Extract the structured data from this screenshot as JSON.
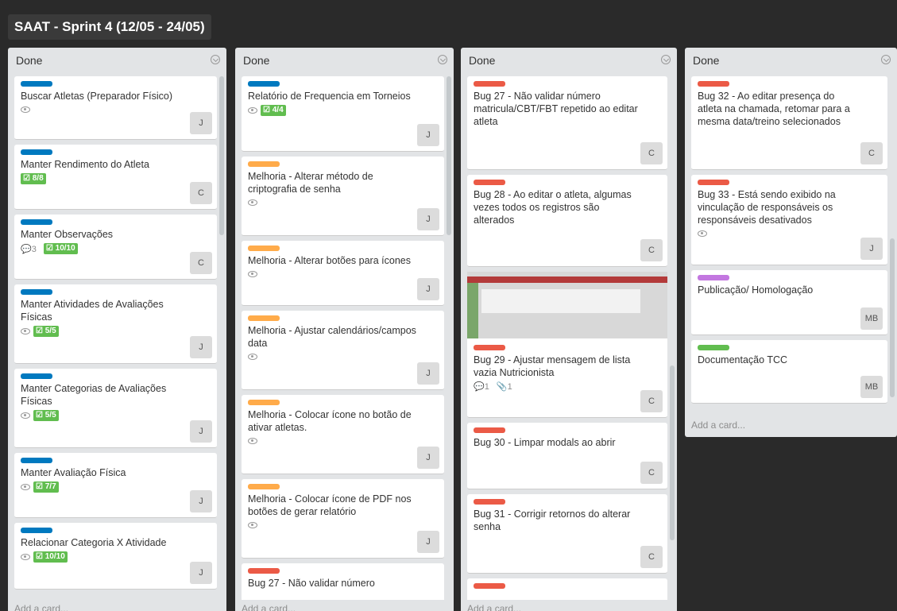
{
  "board": {
    "title": "SAAT - Sprint 4 (12/05 - 24/05)"
  },
  "lists": [
    {
      "title": "Done",
      "add_card": "Add a card...",
      "cards": [
        {
          "title": "Buscar Atletas (Preparador Físico)",
          "label": "blue",
          "watch": true,
          "member": "J"
        },
        {
          "title": "Manter Rendimento do Atleta",
          "label": "blue",
          "checklist": "8/8",
          "member": "C"
        },
        {
          "title": "Manter Observações",
          "label": "blue",
          "comments": "3",
          "checklist": "10/10",
          "member": "C"
        },
        {
          "title": "Manter Atividades de Avaliações Físicas",
          "label": "blue",
          "watch": true,
          "checklist": "5/5",
          "member": "J"
        },
        {
          "title": "Manter Categorias de Avaliações Físicas",
          "label": "blue",
          "watch": true,
          "checklist": "5/5",
          "member": "J"
        },
        {
          "title": "Manter Avaliação Física",
          "label": "blue",
          "watch": true,
          "checklist": "7/7",
          "member": "J"
        },
        {
          "title": "Relacionar Categoria X Atividade",
          "label": "blue",
          "watch": true,
          "checklist": "10/10",
          "member": "J"
        }
      ]
    },
    {
      "title": "Done",
      "add_card": "Add a card...",
      "cards": [
        {
          "title": "Relatório de Frequencia em Torneios",
          "label": "blue",
          "watch": true,
          "checklist": "4/4",
          "member": "J"
        },
        {
          "title": "Melhoria - Alterar método de criptografia de senha",
          "label": "orange",
          "watch": true,
          "member": "J"
        },
        {
          "title": "Melhoria - Alterar botões para ícones",
          "label": "orange",
          "watch": true,
          "member": "J"
        },
        {
          "title": "Melhoria - Ajustar calendários/campos data",
          "label": "orange",
          "watch": true,
          "member": "J"
        },
        {
          "title": "Melhoria - Colocar ícone no botão de ativar atletas.",
          "label": "orange",
          "watch": true,
          "member": "J"
        },
        {
          "title": "Melhoria - Colocar ícone de PDF nos botões de gerar relatório",
          "label": "orange",
          "watch": true,
          "member": "J"
        },
        {
          "title": "Bug 27 - Não validar número",
          "label": "red"
        }
      ]
    },
    {
      "title": "Done",
      "add_card": "Add a card...",
      "cards": [
        {
          "title": "Bug 27 - Não validar número matricula/CBT/FBT repetido ao editar atleta",
          "label": "red",
          "member": "C"
        },
        {
          "title": "Bug 28 - Ao editar o atleta, algumas vezes todos os registros são alterados",
          "label": "red",
          "member": "C"
        },
        {
          "title": "Bug 29 - Ajustar mensagem de lista vazia Nutricionista",
          "label": "red",
          "comments": "1",
          "attachments": "1",
          "member": "C"
        },
        {
          "title": "Bug 30 - Limpar modals ao abrir",
          "label": "red",
          "member": "C"
        },
        {
          "title": "Bug 31 - Corrigir retornos do alterar senha",
          "label": "red",
          "member": "C"
        }
      ]
    },
    {
      "title": "Done",
      "add_card": "Add a card...",
      "cards": [
        {
          "title": "Bug 32 - Ao editar presença do atleta na chamada, retomar para a mesma data/treino selecionados",
          "label": "red",
          "member": "C"
        },
        {
          "title": "Bug 33 - Está sendo exibido na vinculação de responsáveis os responsáveis desativados",
          "label": "red",
          "watch": true,
          "member": "J"
        },
        {
          "title": "Publicação/ Homologação",
          "label": "purple",
          "member": "MB"
        },
        {
          "title": "Documentação TCC",
          "label": "green",
          "member": "MB"
        }
      ]
    }
  ]
}
